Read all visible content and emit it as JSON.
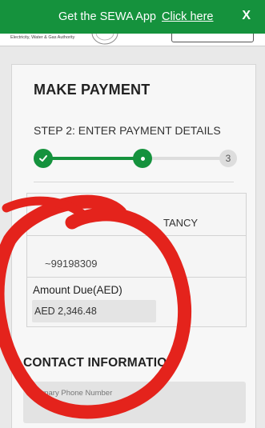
{
  "banner": {
    "message": "Get the SEWA App",
    "link": "Click here",
    "close": "X"
  },
  "header": {
    "authority": "Electricity, Water & Gas Authority"
  },
  "payment": {
    "title": "MAKE PAYMENT",
    "step_label": "STEP 2: ENTER PAYMENT DETAILS",
    "stepper": {
      "step1_icon": "check-icon",
      "step3": "3"
    },
    "account_type_partial": "TANCY",
    "account_number_partial": "~99198309",
    "amount_due_label": "Amount Due(AED)",
    "amount_due_value": "AED 2,346.48"
  },
  "contact": {
    "heading": "CONTACT INFORMATION",
    "phone_placeholder": "Primary Phone Number"
  },
  "colors": {
    "brand_green": "#15923d",
    "annotation_red": "#e4231c"
  }
}
